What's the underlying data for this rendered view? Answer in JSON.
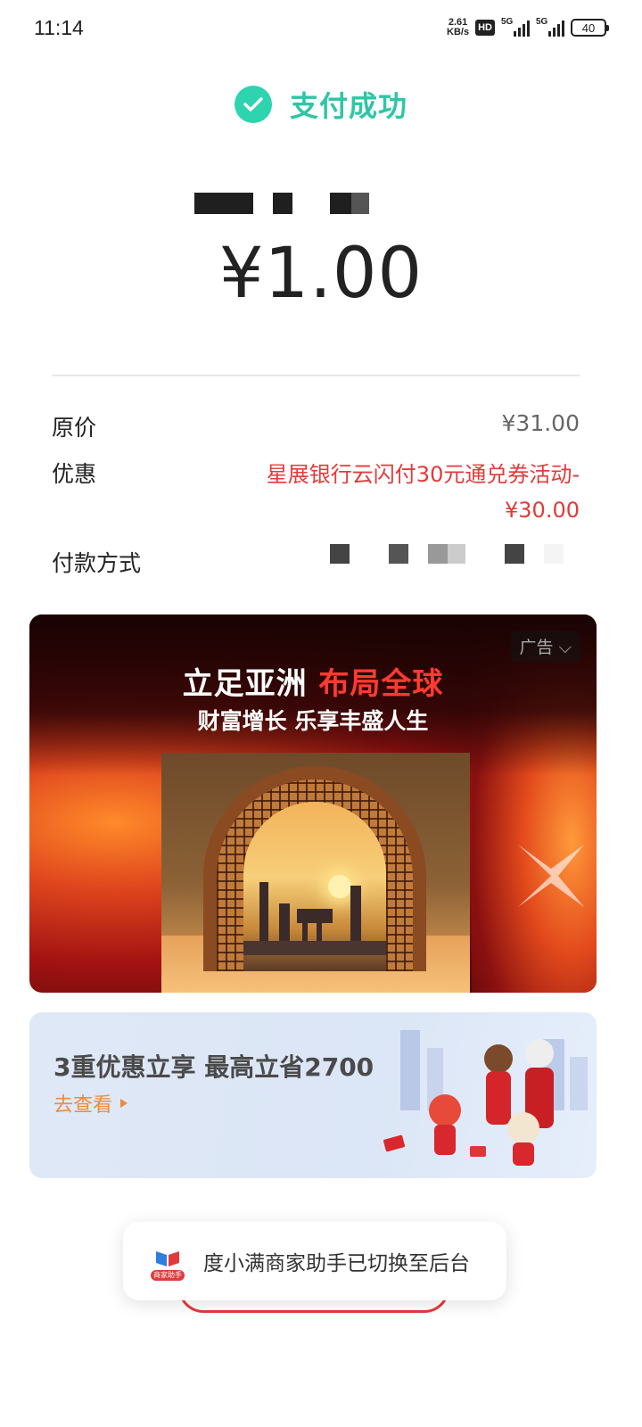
{
  "status_bar": {
    "time": "11:14",
    "net_speed_value": "2.61",
    "net_speed_unit": "KB/s",
    "hd_badge": "HD",
    "sim1_label": "5G",
    "sim2_label": "5G",
    "battery": "40"
  },
  "result": {
    "title": "支付成功",
    "amount": "¥1.00",
    "accent_color": "#2ed3b0"
  },
  "details": {
    "original_price_label": "原价",
    "original_price_value": "¥31.00",
    "discount_label": "优惠",
    "discount_value": "星展银行云闪付30元通兑券活动-¥30.00",
    "payment_method_label": "付款方式"
  },
  "ad": {
    "tag": "广告",
    "title_part1": "立足亚洲 ",
    "title_part2": "布局全球",
    "subtitle": "财富增长 乐享丰盛人生"
  },
  "promo": {
    "title": "3重优惠立享 最高立省2700",
    "link": "去查看"
  },
  "toast": {
    "icon_caption": "商家助手",
    "message": "度小满商家助手已切换至后台"
  }
}
